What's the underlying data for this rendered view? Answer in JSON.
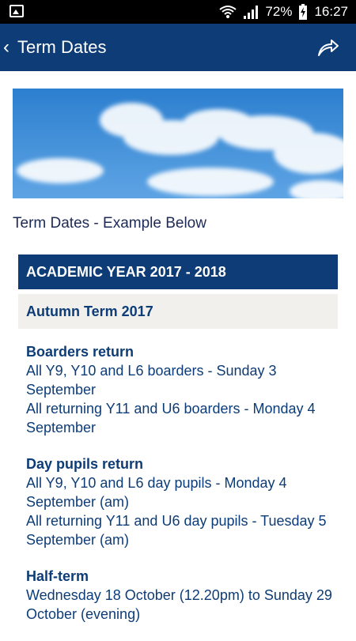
{
  "status_bar": {
    "battery": "72%",
    "time": "16:27"
  },
  "app_bar": {
    "back_icon": "‹",
    "title": "Term Dates"
  },
  "intro": "Term Dates - Example Below",
  "academic_year": "ACADEMIC YEAR 2017 - 2018",
  "term": "Autumn Term 2017",
  "sections": [
    {
      "heading": "Boarders return",
      "lines": [
        "All Y9, Y10 and L6 boarders - Sunday 3 September",
        "All returning Y11 and U6 boarders - Monday 4 September"
      ]
    },
    {
      "heading": "Day pupils return",
      "lines": [
        "All Y9, Y10 and L6 day pupils - Monday 4 September (am)",
        "All returning Y11 and U6 day pupils - Tuesday 5 September (am)"
      ]
    },
    {
      "heading": "Half-term",
      "lines": [
        "Wednesday 18 October (12.20pm) to Sunday 29 October (evening)"
      ]
    }
  ],
  "colors": {
    "primary": "#0d3c77",
    "term_background": "#f2f0ec",
    "intro_text": "#1d2a55"
  },
  "icons": {
    "status_left": "gallery-icon",
    "status_wifi": "wifi-icon",
    "status_signal": "signal-icon",
    "status_battery": "battery-charging-icon",
    "share": "share-icon"
  }
}
